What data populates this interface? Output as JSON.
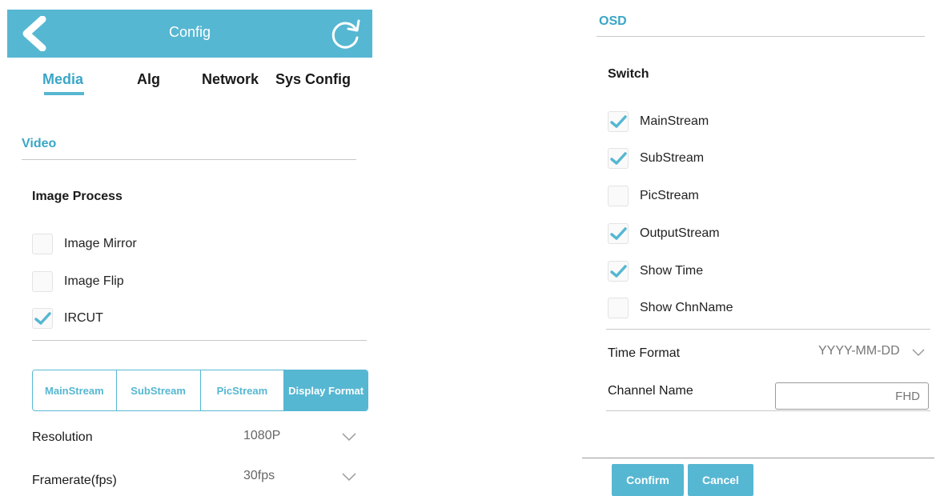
{
  "colors": {
    "accent": "#56b7d2",
    "accent_text": "#3aa6c6",
    "divider": "#c8c8c8"
  },
  "header": {
    "title": "Config",
    "back_icon": "chevron-left-icon",
    "refresh_icon": "refresh-icon"
  },
  "tabs": [
    {
      "label": "Media",
      "active": true
    },
    {
      "label": "Alg",
      "active": false
    },
    {
      "label": "Network",
      "active": false
    },
    {
      "label": "Sys Config",
      "active": false
    }
  ],
  "video": {
    "section_title": "Video",
    "image_process": {
      "heading": "Image Process",
      "options": [
        {
          "label": "Image Mirror",
          "checked": false
        },
        {
          "label": "Image Flip",
          "checked": false
        },
        {
          "label": "IRCUT",
          "checked": true
        }
      ]
    },
    "stream_tabs": [
      {
        "label": "MainStream",
        "active": false
      },
      {
        "label": "SubStream",
        "active": false
      },
      {
        "label": "PicStream",
        "active": false
      },
      {
        "label": "Display Format",
        "active": true
      }
    ],
    "settings": [
      {
        "label": "Resolution",
        "value": "1080P"
      },
      {
        "label": "Framerate(fps)",
        "value": "30fps"
      }
    ]
  },
  "osd": {
    "section_title": "OSD",
    "switch": {
      "heading": "Switch",
      "options": [
        {
          "label": "MainStream",
          "checked": true
        },
        {
          "label": "SubStream",
          "checked": true
        },
        {
          "label": "PicStream",
          "checked": false
        },
        {
          "label": "OutputStream",
          "checked": true
        },
        {
          "label": "Show Time",
          "checked": true
        },
        {
          "label": "Show ChnName",
          "checked": false
        }
      ]
    },
    "time_format": {
      "label": "Time Format",
      "value": "YYYY-MM-DD"
    },
    "channel_name": {
      "label": "Channel Name",
      "value": "FHD"
    },
    "confirm_label": "Confirm",
    "cancel_label": "Cancel"
  }
}
